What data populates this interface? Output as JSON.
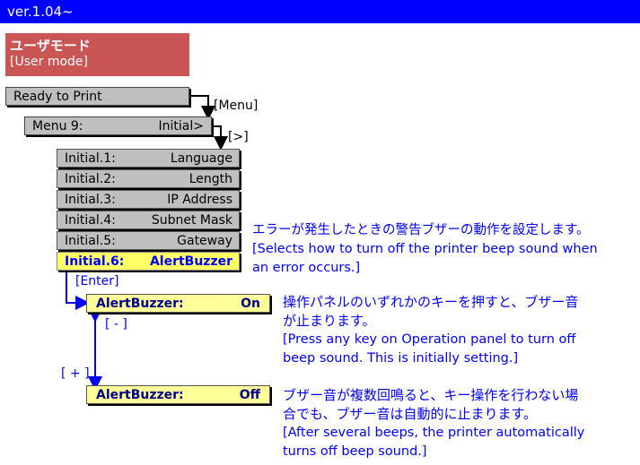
{
  "header": {
    "version": "ver.1.04~"
  },
  "mode": {
    "label_jp": "ユーザモード",
    "label_en": "[User mode]"
  },
  "flow": {
    "ready": "Ready to Print",
    "menu_key": "[Menu]",
    "menu_left": "Menu  9:",
    "menu_right": "Initial>",
    "next_key": "[>]",
    "initial_items": [
      {
        "num": "Initial.1:",
        "name": "Language"
      },
      {
        "num": "Initial.2:",
        "name": "Length"
      },
      {
        "num": "Initial.3:",
        "name": "IP Address"
      },
      {
        "num": "Initial.4:",
        "name": "Subnet Mask"
      },
      {
        "num": "Initial.5:",
        "name": "Gateway"
      },
      {
        "num": "Initial.6:",
        "name": "AlertBuzzer"
      }
    ],
    "enter_key": "[Enter]",
    "minus_key": "[ - ]",
    "plus_key": "[ + ]",
    "on_item": {
      "label": "AlertBuzzer:",
      "value": "On"
    },
    "off_item": {
      "label": "AlertBuzzer:",
      "value": "Off"
    }
  },
  "descriptions": {
    "alert_jp": "エラーが発生したときの警告ブザーの動作を設定します。",
    "alert_en_1": "[Selects how to turn off the printer beep sound when",
    "alert_en_2": "an error occurs.]",
    "on_jp_1": "操作パネルのいずれかのキーを押すと、ブザー音",
    "on_jp_2": "が止まります。",
    "on_en_1": "[Press any key on Operation panel to turn off",
    "on_en_2": "beep sound. This is initially setting.]",
    "off_jp_1": "ブザー音が複数回鳴ると、キー操作を行わない場",
    "off_jp_2": "合でも、ブザー音は自動的に止まります。",
    "off_en_1": "[After several beeps, the printer automatically",
    "off_en_2": "turns off beep sound.]"
  },
  "colors": {
    "header_bar": "#0000ff",
    "mode_box": "#c95555",
    "selected": "#ffff66",
    "text_blue": "#0000ff"
  }
}
